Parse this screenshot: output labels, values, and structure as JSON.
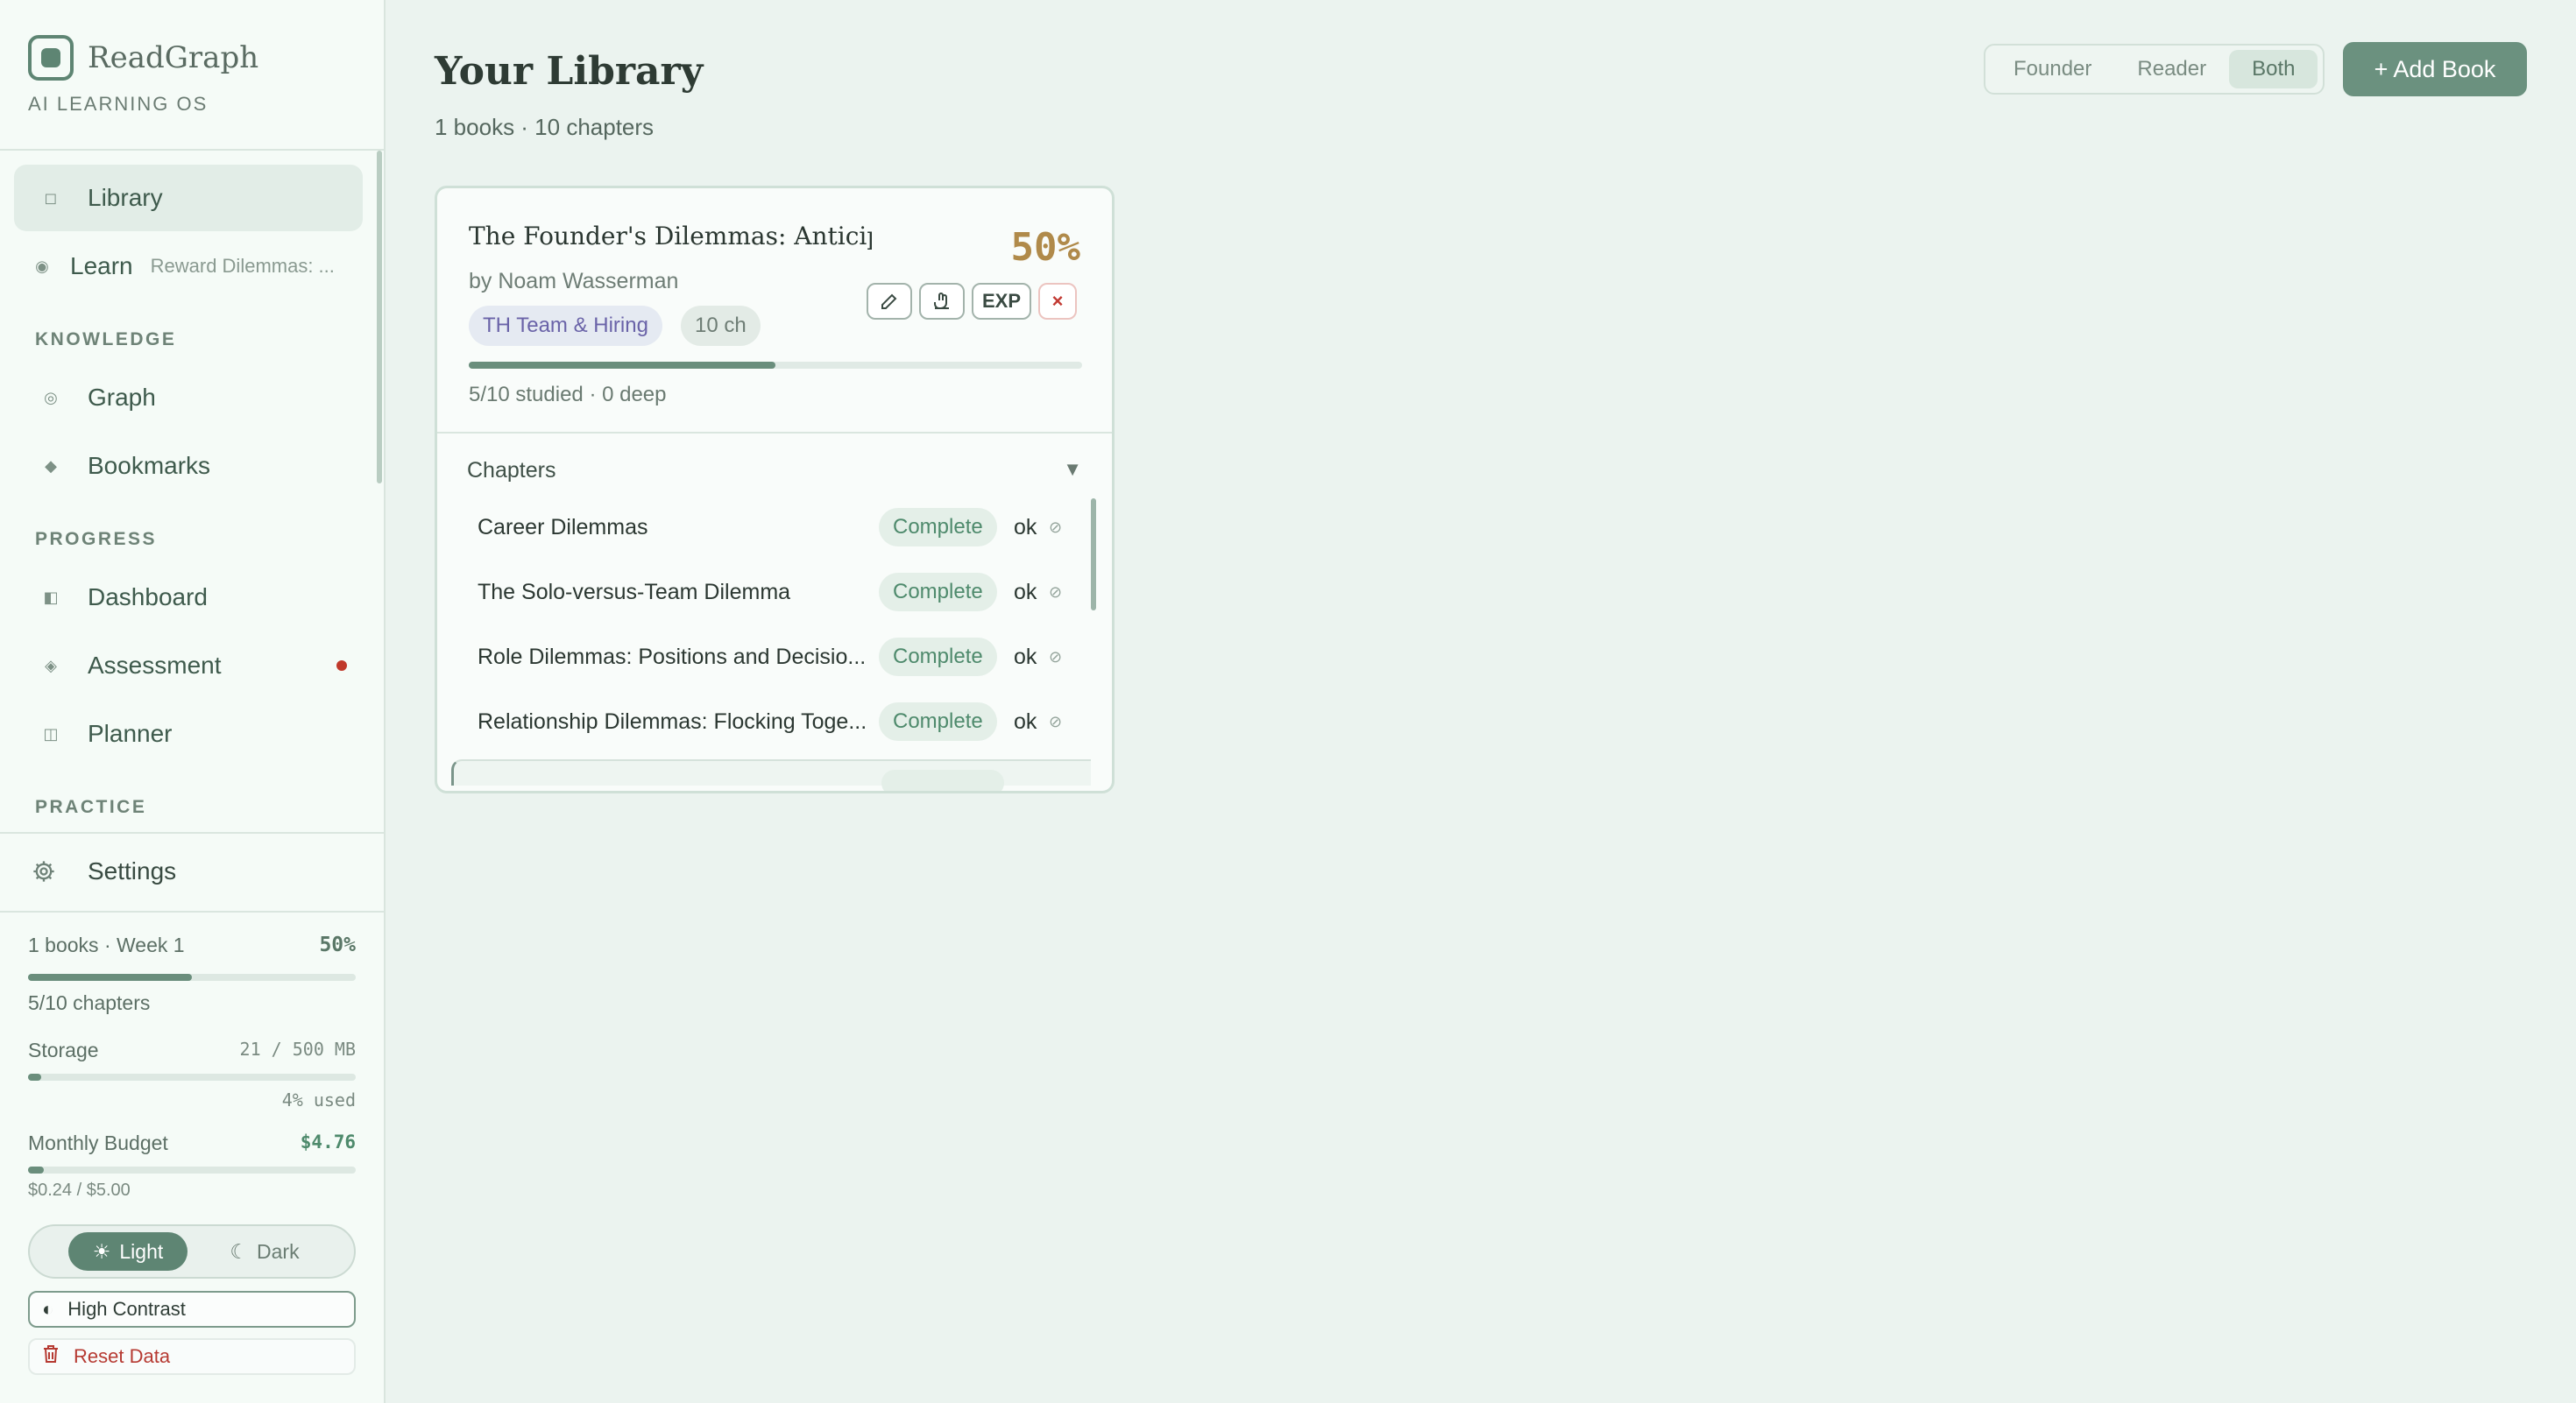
{
  "app": {
    "name": "ReadGraph",
    "tagline": "AI LEARNING OS"
  },
  "nav": {
    "library": "Library",
    "learn": "Learn",
    "learn_sub": "Reward Dilemmas: ...",
    "section_knowledge": "KNOWLEDGE",
    "graph": "Graph",
    "bookmarks": "Bookmarks",
    "section_progress": "PROGRESS",
    "dashboard": "Dashboard",
    "assessment": "Assessment",
    "planner": "Planner",
    "section_practice": "PRACTICE",
    "settings": "Settings"
  },
  "stats": {
    "summary": "1 books · Week 1",
    "percent": "50%",
    "percent_value": 0.5,
    "chapters": "5/10 chapters",
    "storage_label": "Storage",
    "storage_value": "21 / 500 MB",
    "storage_fraction": 0.04,
    "storage_used": "4% used",
    "budget_label": "Monthly Budget",
    "budget_value": "$4.76",
    "budget_fraction": 0.048,
    "budget_detail": "$0.24 / $5.00"
  },
  "theme": {
    "light": "Light",
    "dark": "Dark",
    "selected": "Light"
  },
  "buttons": {
    "high_contrast": "High Contrast",
    "reset": "Reset Data",
    "add_book": "+ Add Book"
  },
  "page": {
    "title": "Your Library",
    "subtitle": "1 books · 10 chapters"
  },
  "view_modes": [
    "Founder",
    "Reader",
    "Both"
  ],
  "view_selected": "Both",
  "book": {
    "title": "The Founder's Dilemmas: Anticipa...",
    "author": "by Noam Wasserman",
    "percent": "50%",
    "progress": 0.5,
    "category": "TH Team & Hiring",
    "chapters_tag": "10 ch",
    "actions": {
      "export": "EXP",
      "delete": "×"
    },
    "stats": "5/10 studied · 0 deep",
    "chapters_header": "Chapters",
    "chapters": [
      {
        "name": "Career Dilemmas",
        "status": "Complete",
        "quality": "ok"
      },
      {
        "name": "The Solo-versus-Team Dilemma",
        "status": "Complete",
        "quality": "ok"
      },
      {
        "name": "Role Dilemmas: Positions and Decisio...",
        "status": "Complete",
        "quality": "ok"
      },
      {
        "name": "Relationship Dilemmas: Flocking Toge...",
        "status": "Complete",
        "quality": "ok"
      }
    ]
  },
  "colors": {
    "accent": "#5e8573",
    "percent": "#b08a4a",
    "danger": "#c0392b",
    "complete": "#4e8a6c"
  }
}
